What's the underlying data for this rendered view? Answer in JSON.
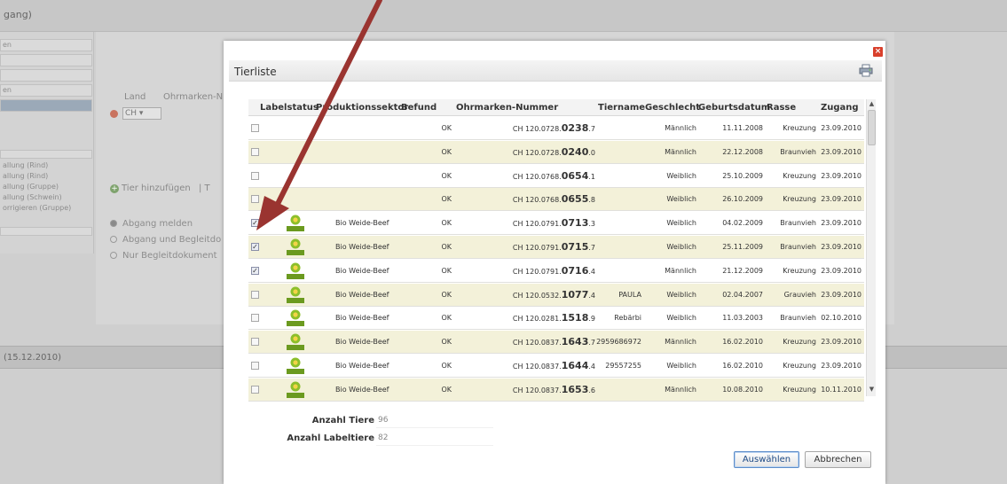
{
  "background": {
    "header_title": "gang)",
    "nav_items": [
      "en",
      "",
      "",
      "en",
      ""
    ],
    "sub_items": [
      "allung (Rind)",
      "allung (Rind)",
      "allung (Gruppe)",
      "allung (Schwein)",
      "orrigieren (Gruppe)"
    ],
    "land_label": "Land",
    "ohrmarken_label": "Ohrmarken-N",
    "country_value": "CH",
    "add_animal": "Tier hinzufügen",
    "add_animal_extra": "T",
    "radios": [
      "Abgang melden",
      "Abgang und Begleitdo",
      "Nur Begleitdokument"
    ],
    "footer_text": "(15.12.2010)"
  },
  "dialog": {
    "title": "Tierliste",
    "close_glyph": "×",
    "columns": {
      "labelstatus": "Labelstatus",
      "produktionssektor": "Produktionssektor",
      "befund": "Befund",
      "ohrmarke": "Ohrmarken-Nummer",
      "tiername": "Tiername",
      "geschlecht": "Geschlecht",
      "geburtsdatum": "Geburtsdatum",
      "rasse": "Rasse",
      "zugang": "Zugang"
    },
    "rows": [
      {
        "checked": false,
        "label": false,
        "sektor": "",
        "befund": "OK",
        "ohr_prefix": "CH 120.0728.",
        "ohr_main": "0238",
        "ohr_suffix": ".7",
        "tiername": "",
        "geschlecht": "Männlich",
        "geburt": "11.11.2008",
        "rasse": "Kreuzung",
        "zugang": "23.09.2010"
      },
      {
        "checked": false,
        "label": false,
        "sektor": "",
        "befund": "OK",
        "ohr_prefix": "CH 120.0728.",
        "ohr_main": "0240",
        "ohr_suffix": ".0",
        "tiername": "",
        "geschlecht": "Männlich",
        "geburt": "22.12.2008",
        "rasse": "Braunvieh",
        "zugang": "23.09.2010"
      },
      {
        "checked": false,
        "label": false,
        "sektor": "",
        "befund": "OK",
        "ohr_prefix": "CH 120.0768.",
        "ohr_main": "0654",
        "ohr_suffix": ".1",
        "tiername": "",
        "geschlecht": "Weiblich",
        "geburt": "25.10.2009",
        "rasse": "Kreuzung",
        "zugang": "23.09.2010"
      },
      {
        "checked": false,
        "label": false,
        "sektor": "",
        "befund": "OK",
        "ohr_prefix": "CH 120.0768.",
        "ohr_main": "0655",
        "ohr_suffix": ".8",
        "tiername": "",
        "geschlecht": "Weiblich",
        "geburt": "26.10.2009",
        "rasse": "Kreuzung",
        "zugang": "23.09.2010"
      },
      {
        "checked": true,
        "label": true,
        "sektor": "Bio Weide-Beef",
        "befund": "OK",
        "ohr_prefix": "CH 120.0791.",
        "ohr_main": "0713",
        "ohr_suffix": ".3",
        "tiername": "",
        "geschlecht": "Weiblich",
        "geburt": "04.02.2009",
        "rasse": "Braunvieh",
        "zugang": "23.09.2010"
      },
      {
        "checked": true,
        "label": true,
        "sektor": "Bio Weide-Beef",
        "befund": "OK",
        "ohr_prefix": "CH 120.0791.",
        "ohr_main": "0715",
        "ohr_suffix": ".7",
        "tiername": "",
        "geschlecht": "Weiblich",
        "geburt": "25.11.2009",
        "rasse": "Braunvieh",
        "zugang": "23.09.2010"
      },
      {
        "checked": true,
        "label": true,
        "sektor": "Bio Weide-Beef",
        "befund": "OK",
        "ohr_prefix": "CH 120.0791.",
        "ohr_main": "0716",
        "ohr_suffix": ".4",
        "tiername": "",
        "geschlecht": "Männlich",
        "geburt": "21.12.2009",
        "rasse": "Kreuzung",
        "zugang": "23.09.2010"
      },
      {
        "checked": false,
        "label": true,
        "sektor": "Bio Weide-Beef",
        "befund": "OK",
        "ohr_prefix": "CH 120.0532.",
        "ohr_main": "1077",
        "ohr_suffix": ".4",
        "tiername": "PAULA",
        "geschlecht": "Weiblich",
        "geburt": "02.04.2007",
        "rasse": "Grauvieh",
        "zugang": "23.09.2010"
      },
      {
        "checked": false,
        "label": true,
        "sektor": "Bio Weide-Beef",
        "befund": "OK",
        "ohr_prefix": "CH 120.0281.",
        "ohr_main": "1518",
        "ohr_suffix": ".9",
        "tiername": "Rebärbi",
        "geschlecht": "Weiblich",
        "geburt": "11.03.2003",
        "rasse": "Braunvieh",
        "zugang": "02.10.2010"
      },
      {
        "checked": false,
        "label": true,
        "sektor": "Bio Weide-Beef",
        "befund": "OK",
        "ohr_prefix": "CH 120.0837.",
        "ohr_main": "1643",
        "ohr_suffix": ".7",
        "tiername": "2959686972",
        "geschlecht": "Männlich",
        "geburt": "16.02.2010",
        "rasse": "Kreuzung",
        "zugang": "23.09.2010"
      },
      {
        "checked": false,
        "label": true,
        "sektor": "Bio Weide-Beef",
        "befund": "OK",
        "ohr_prefix": "CH 120.0837.",
        "ohr_main": "1644",
        "ohr_suffix": ".4",
        "tiername": "29557255",
        "geschlecht": "Weiblich",
        "geburt": "16.02.2010",
        "rasse": "Kreuzung",
        "zugang": "23.09.2010"
      },
      {
        "checked": false,
        "label": true,
        "sektor": "Bio Weide-Beef",
        "befund": "OK",
        "ohr_prefix": "CH 120.0837.",
        "ohr_main": "1653",
        "ohr_suffix": ".6",
        "tiername": "",
        "geschlecht": "Männlich",
        "geburt": "10.08.2010",
        "rasse": "Kreuzung",
        "zugang": "10.11.2010"
      }
    ],
    "summary": {
      "anzahl_tiere_label": "Anzahl Tiere",
      "anzahl_tiere_value": "96",
      "anzahl_labeltiere_label": "Anzahl Labeltiere",
      "anzahl_labeltiere_value": "82"
    },
    "buttons": {
      "select": "Auswählen",
      "cancel": "Abbrechen"
    }
  },
  "colors": {
    "row_alt": "#f3f1d9",
    "arrow": "#9a3430",
    "label_icon": "#6b9a1f"
  },
  "icons": {
    "close": "close-icon",
    "print": "print-icon",
    "label": "bio-label-icon"
  }
}
